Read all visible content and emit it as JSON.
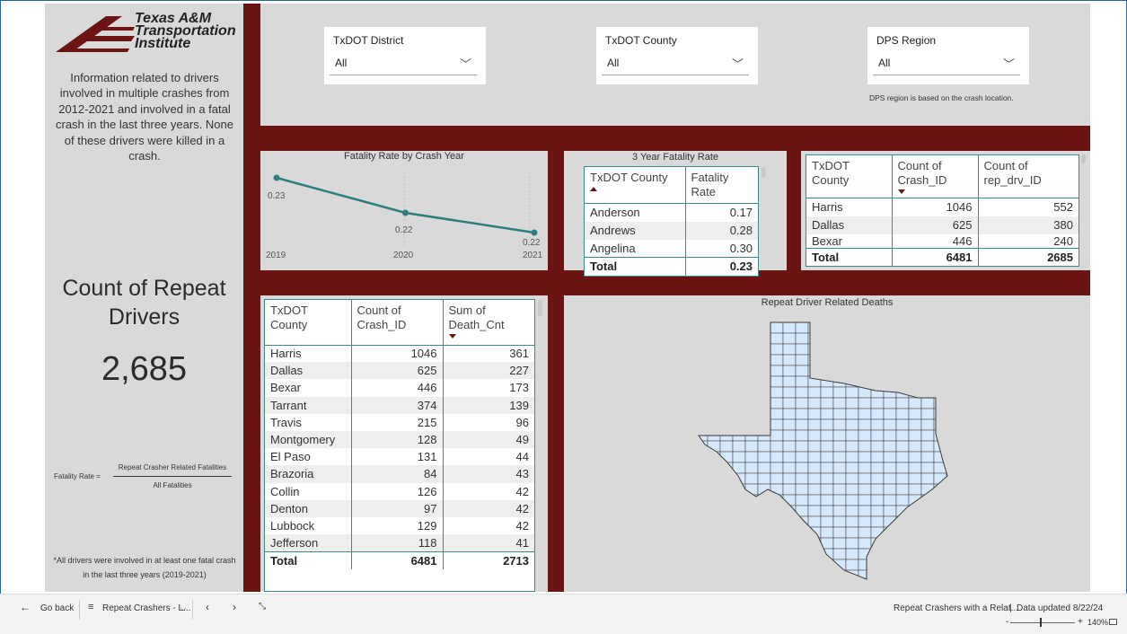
{
  "logo": {
    "line1": "Texas A&M",
    "line2": "Transportation",
    "line3": "Institute"
  },
  "info_text": "Information related to drivers involved in multiple crashes from 2012-2021 and involved in a fatal crash in the last three years. None of these drivers were killed in a crash.",
  "kpi": {
    "title": "Count of Repeat Drivers",
    "value": "2,685"
  },
  "formula": {
    "lhs": "Fatality Rate =",
    "numerator": "Repeat Crasher Related Fatalities",
    "denominator": "All Fatalities"
  },
  "footnote": "*All drivers were involved in at least one fatal crash in the last three years  (2019-2021)",
  "slicers": [
    {
      "label": "TxDOT District",
      "value": "All"
    },
    {
      "label": "TxDOT County",
      "value": "All"
    },
    {
      "label": "DPS Region",
      "value": "All"
    }
  ],
  "dps_note": "DPS region is based on the crash location.",
  "chart_data": {
    "type": "line",
    "title": "Fatality Rate by Crash Year",
    "x": [
      "2019",
      "2020",
      "2021"
    ],
    "series": [
      {
        "values": [
          0.23,
          0.22,
          0.22
        ]
      }
    ],
    "data_labels": [
      "0.23",
      "0.22",
      "0.22"
    ],
    "color": "#2e7d7d"
  },
  "fatality_table": {
    "title": "3 Year Fatality Rate",
    "headers": [
      "TxDOT County",
      "Fatality Rate"
    ],
    "rows": [
      [
        "Anderson",
        "0.17"
      ],
      [
        "Andrews",
        "0.28"
      ],
      [
        "Angelina",
        "0.30"
      ]
    ],
    "total": [
      "Total",
      "0.23"
    ]
  },
  "crash_driver_table": {
    "headers": [
      "TxDOT County",
      "Count of Crash_ID",
      "Count of rep_drv_ID"
    ],
    "rows": [
      [
        "Harris",
        "1046",
        "552"
      ],
      [
        "Dallas",
        "625",
        "380"
      ],
      [
        "Bexar",
        "446",
        "240"
      ]
    ],
    "total": [
      "Total",
      "6481",
      "2685"
    ]
  },
  "death_table": {
    "headers": [
      "TxDOT County",
      "Count of Crash_ID",
      "Sum of Death_Cnt"
    ],
    "rows": [
      [
        "Harris",
        "1046",
        "361"
      ],
      [
        "Dallas",
        "625",
        "227"
      ],
      [
        "Bexar",
        "446",
        "173"
      ],
      [
        "Tarrant",
        "374",
        "139"
      ],
      [
        "Travis",
        "215",
        "96"
      ],
      [
        "Montgomery",
        "128",
        "49"
      ],
      [
        "El Paso",
        "131",
        "44"
      ],
      [
        "Brazoria",
        "84",
        "43"
      ],
      [
        "Collin",
        "126",
        "42"
      ],
      [
        "Denton",
        "97",
        "42"
      ],
      [
        "Lubbock",
        "129",
        "42"
      ],
      [
        "Jefferson",
        "118",
        "41"
      ]
    ],
    "total": [
      "Total",
      "6481",
      "2713"
    ]
  },
  "map": {
    "title": "Repeat Driver Related Deaths"
  },
  "taskbar": {
    "back": "Go back",
    "page": "Repeat Crashers - L...",
    "report": "Repeat Crashers with a Relat...",
    "updated": "Data updated 8/22/24",
    "zoom": "140%"
  },
  "colors": {
    "maroon": "#6b1414",
    "panel": "#d9d9d9",
    "teal": "#3c8a8a"
  }
}
